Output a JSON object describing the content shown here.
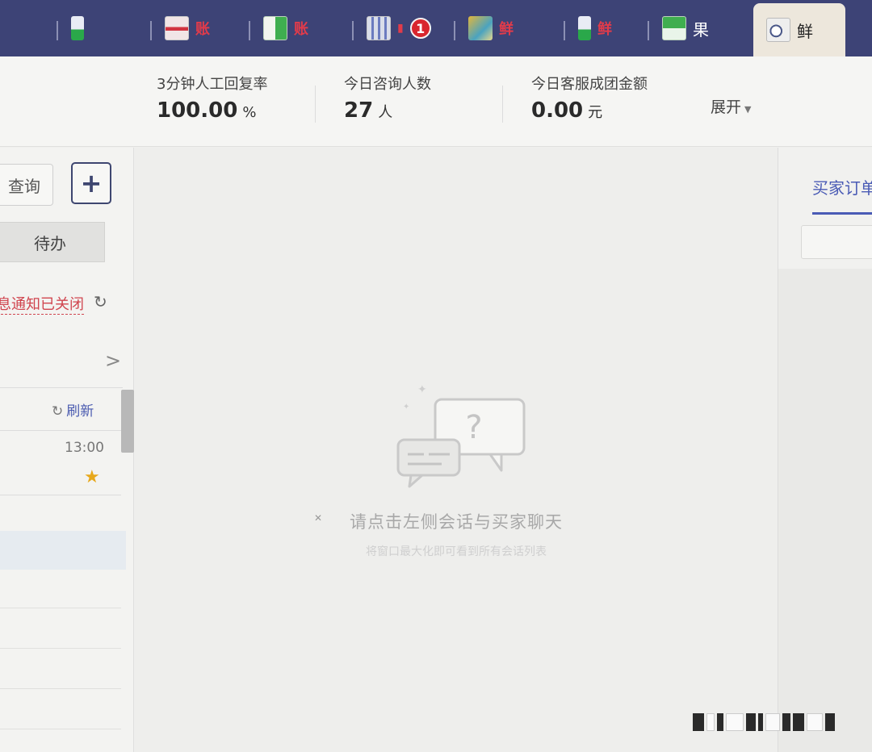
{
  "taskbar": {
    "items": [
      {
        "icon": "phone-app-icon",
        "label": ""
      },
      {
        "icon": "red-app-icon",
        "label": "账"
      },
      {
        "icon": "green-app-icon",
        "label": "账"
      },
      {
        "icon": "bars-app-icon",
        "label": "",
        "badge": "1"
      },
      {
        "icon": "photo-app-icon",
        "label": "鲜"
      },
      {
        "icon": "phone-app-icon",
        "label": "鲜"
      },
      {
        "icon": "grid-app-icon",
        "label": "果"
      },
      {
        "icon": "compass-app-icon",
        "label": "鲜",
        "active": true
      }
    ]
  },
  "stats": {
    "reply_rate_label": "3分钟人工回复率",
    "reply_rate_value": "100.00",
    "reply_rate_unit": "%",
    "consult_label": "今日咨询人数",
    "consult_value": "27",
    "consult_unit": "人",
    "amount_label": "今日客服成团金额",
    "amount_value": "0.00",
    "amount_unit": "元",
    "expand_label": "展开"
  },
  "left_panel": {
    "query_label": "查询",
    "add_label": "+",
    "todo_tab": "待办",
    "notify_text": "息通知已关闭",
    "refresh_label": "刷新",
    "conversation_time": "13:00"
  },
  "center": {
    "empty_message": "请点击左侧会话与买家聊天",
    "empty_hint": "将窗口最大化即可看到所有会话列表"
  },
  "right_panel": {
    "tab_label": "买家订单"
  },
  "colors": {
    "taskbar_bg": "#3d4376",
    "accent_blue": "#4a5bb5",
    "alert_red": "#d0454f",
    "star": "#e7a81c"
  }
}
